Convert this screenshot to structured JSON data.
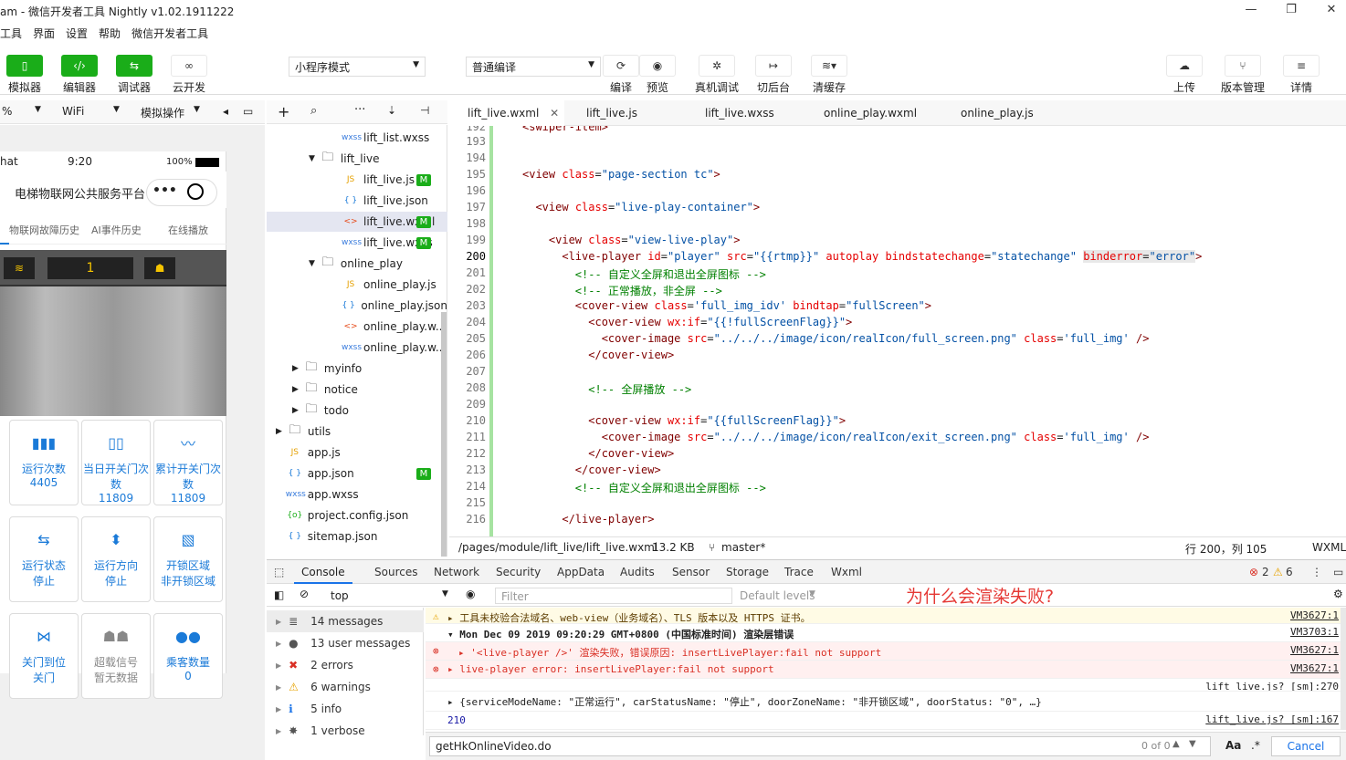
{
  "window": {
    "title": "am - 微信开发者工具 Nightly v1.02.1911222",
    "minimize": "—",
    "maximize": "❐",
    "close": "✕"
  },
  "menu": [
    "工具",
    "界面",
    "设置",
    "帮助",
    "微信开发者工具"
  ],
  "toolbar": {
    "simulator": "模拟器",
    "editor": "编辑器",
    "debugger": "调试器",
    "cloud": "云开发",
    "mode": "小程序模式",
    "compile_mode": "普通编译",
    "compile": "编译",
    "preview": "预览",
    "remote_debug": "真机调试",
    "background": "切后台",
    "clear_cache": "清缓存",
    "upload": "上传",
    "version": "版本管理",
    "details": "详情"
  },
  "simtool": {
    "zoom": "%",
    "network": "WiFi",
    "ops": "模拟操作"
  },
  "phone": {
    "carrier": "hat",
    "time": "9:20",
    "battery": "100%",
    "title": "电梯物联网公共服务平台",
    "tabs": [
      "物联网故障历史",
      "AI事件历史",
      "在线播放"
    ],
    "floor": "1",
    "stats": [
      {
        "label": "运行次数",
        "value": "4405",
        "color": "#1a7ad8"
      },
      {
        "label": "当日开关门次数",
        "value": "11809",
        "color": "#1a7ad8"
      },
      {
        "label": "累计开关门次数",
        "value": "11809",
        "color": "#1a7ad8"
      },
      {
        "label": "运行状态",
        "value": "停止",
        "color": "#1a7ad8"
      },
      {
        "label": "运行方向",
        "value": "停止",
        "color": "#1a7ad8"
      },
      {
        "label": "开锁区域",
        "value": "非开锁区域",
        "color": "#1a7ad8"
      },
      {
        "label": "关门到位",
        "value": "关门",
        "color": "#1a7ad8"
      },
      {
        "label": "超载信号",
        "value": "暂无数据",
        "color": "#888888"
      },
      {
        "label": "乘客数量",
        "value": "0",
        "color": "#1a7ad8"
      }
    ]
  },
  "explorer": [
    {
      "name": "lift_list.wxss",
      "type": "wxss",
      "indent": 2
    },
    {
      "name": "lift_live",
      "type": "folder-open",
      "indent": 1
    },
    {
      "name": "lift_live.js",
      "type": "js",
      "indent": 2,
      "m": "M"
    },
    {
      "name": "lift_live.json",
      "type": "json",
      "indent": 2
    },
    {
      "name": "lift_live.wxml",
      "type": "wxml",
      "indent": 2,
      "m": "M",
      "selected": true
    },
    {
      "name": "lift_live.wxss",
      "type": "wxss",
      "indent": 2,
      "m": "M"
    },
    {
      "name": "online_play",
      "type": "folder-open",
      "indent": 1
    },
    {
      "name": "online_play.js",
      "type": "js",
      "indent": 2
    },
    {
      "name": "online_play.json",
      "type": "json",
      "indent": 2
    },
    {
      "name": "online_play.w...",
      "type": "wxml",
      "indent": 2
    },
    {
      "name": "online_play.w...",
      "type": "wxss",
      "indent": 2
    },
    {
      "name": "myinfo",
      "type": "folder",
      "indent": 0.5
    },
    {
      "name": "notice",
      "type": "folder",
      "indent": 0.5
    },
    {
      "name": "todo",
      "type": "folder",
      "indent": 0.5
    },
    {
      "name": "utils",
      "type": "folder",
      "indent": 0
    },
    {
      "name": "app.js",
      "type": "js",
      "indent": 0.3
    },
    {
      "name": "app.json",
      "type": "json",
      "indent": 0.3,
      "m": "M"
    },
    {
      "name": "app.wxss",
      "type": "wxss",
      "indent": 0.3
    },
    {
      "name": "project.config.json",
      "type": "config",
      "indent": 0.3
    },
    {
      "name": "sitemap.json",
      "type": "json",
      "indent": 0.3
    }
  ],
  "tabs": [
    "lift_live.wxml",
    "lift_live.js",
    "lift_live.wxss",
    "online_play.wxml",
    "online_play.js"
  ],
  "code": [
    {
      "n": "193",
      "html": ""
    },
    {
      "n": "194",
      "html": ""
    },
    {
      "n": "195",
      "html": "<span class='tg'>&lt;view</span> <span class='at'>class</span>=<span class='st'>\"page-section tc\"</span><span class='tg'>&gt;</span>"
    },
    {
      "n": "196",
      "html": ""
    },
    {
      "n": "197",
      "html": "  <span class='tg'>&lt;view</span> <span class='at'>class</span>=<span class='st'>\"live-play-container\"</span><span class='tg'>&gt;</span>"
    },
    {
      "n": "198",
      "html": ""
    },
    {
      "n": "199",
      "html": "    <span class='tg'>&lt;view</span> <span class='at'>class</span>=<span class='st'>\"view-live-play\"</span><span class='tg'>&gt;</span>"
    },
    {
      "n": "200",
      "html": "      <span class='tg'>&lt;live-player</span> <span class='at'>id</span>=<span class='st'>\"player\"</span> <span class='at'>src</span>=<span class='st'>\"{{rtmp}}\"</span> <span class='at'>autoplay</span> <span class='at'>bindstatechange</span>=<span class='st'>\"statechange\"</span> <span class='at' style='background:#e8e8e8'>binderror</span><span style='background:#e8e8e8'>=</span><span class='st' style='background:#e8e8e8'>\"error\"</span><span class='tg'>&gt;</span>"
    },
    {
      "n": "201",
      "html": "        <span class='cm'>&lt;!-- 自定义全屏和退出全屏图标 --&gt;</span>"
    },
    {
      "n": "202",
      "html": "        <span class='cm'>&lt;!-- 正常播放，非全屏 --&gt;</span>"
    },
    {
      "n": "203",
      "html": "        <span class='tg'>&lt;cover-view</span> <span class='at'>class</span>=<span class='st'>'full_img_idv'</span> <span class='at'>bindtap</span>=<span class='st'>\"fullScreen\"</span><span class='tg'>&gt;</span>"
    },
    {
      "n": "204",
      "html": "          <span class='tg'>&lt;cover-view</span> <span class='at'>wx:if</span>=<span class='st'>\"{{!fullScreenFlag}}\"</span><span class='tg'>&gt;</span>"
    },
    {
      "n": "205",
      "html": "            <span class='tg'>&lt;cover-image</span> <span class='at'>src</span>=<span class='st'>\"../../../image/icon/realIcon/full_screen.png\"</span> <span class='at'>class</span>=<span class='st'>'full_img'</span> <span class='tg'>/&gt;</span>"
    },
    {
      "n": "206",
      "html": "          <span class='tg'>&lt;/cover-view&gt;</span>"
    },
    {
      "n": "207",
      "html": ""
    },
    {
      "n": "208",
      "html": "          <span class='cm'>&lt;!-- 全屏播放 --&gt;</span>"
    },
    {
      "n": "209",
      "html": ""
    },
    {
      "n": "210",
      "html": "          <span class='tg'>&lt;cover-view</span> <span class='at'>wx:if</span>=<span class='st'>\"{{fullScreenFlag}}\"</span><span class='tg'>&gt;</span>"
    },
    {
      "n": "211",
      "html": "            <span class='tg'>&lt;cover-image</span> <span class='at'>src</span>=<span class='st'>\"../../../image/icon/realIcon/exit_screen.png\"</span> <span class='at'>class</span>=<span class='st'>'full_img'</span> <span class='tg'>/&gt;</span>"
    },
    {
      "n": "212",
      "html": "          <span class='tg'>&lt;/cover-view&gt;</span>"
    },
    {
      "n": "213",
      "html": "        <span class='tg'>&lt;/cover-view&gt;</span>"
    },
    {
      "n": "214",
      "html": "        <span class='cm'>&lt;!-- 自定义全屏和退出全屏图标 --&gt;</span>"
    },
    {
      "n": "215",
      "html": ""
    },
    {
      "n": "216",
      "html": "      <span class='tg'>&lt;/live-player&gt;</span>"
    }
  ],
  "statusline": {
    "path": "/pages/module/lift_live/lift_live.wxml",
    "size": "13.2 KB",
    "branch": "master*",
    "cursor": "行 200，列 105",
    "lang": "WXML"
  },
  "devtabs": [
    "Console",
    "Sources",
    "Network",
    "Security",
    "AppData",
    "Audits",
    "Sensor",
    "Storage",
    "Trace",
    "Wxml"
  ],
  "devcounts": {
    "errors": "2",
    "warnings": "6"
  },
  "ctool": {
    "context": "top",
    "filter": "Filter",
    "levels": "Default levels"
  },
  "annotation": "为什么会渲染失败?",
  "panel": [
    {
      "label": "14 messages",
      "icon": "list"
    },
    {
      "label": "13 user messages",
      "icon": "user"
    },
    {
      "label": "2 errors",
      "icon": "error"
    },
    {
      "label": "6 warnings",
      "icon": "warning"
    },
    {
      "label": "5 info",
      "icon": "info"
    },
    {
      "label": "1 verbose",
      "icon": "verbose"
    }
  ],
  "log": [
    {
      "text": "▸ 工具未校验合法域名、web-view（业务域名）、TLS 版本以及 HTTPS 证书。",
      "src": "VM3627:1",
      "kind": "warn"
    },
    {
      "text": "▾ Mon Dec 09 2019 09:20:29 GMT+0800 (中国标准时间) 渲染层错误",
      "src": "VM3703:1",
      "kind": "group"
    },
    {
      "text": "▸ '<live-player />' 渲染失败，错误原因: insertLivePlayer:fail not support",
      "src": "VM3627:1",
      "kind": "error"
    },
    {
      "text": "▸ live-player error: insertLivePlayer:fail not support",
      "src": "VM3627:1",
      "kind": "error"
    },
    {
      "text": "",
      "src": "lift_live.js? [sm]:270",
      "kind": "plain"
    },
    {
      "text": "▸ {serviceModeName: \"正常运行\", carStatusName: \"停止\", doorZoneName: \"非开锁区域\", doorStatus: \"0\", …}",
      "src": "",
      "kind": "plain"
    },
    {
      "text": "210",
      "src": "lift_live.js? [sm]:167",
      "kind": "num"
    }
  ],
  "search": {
    "value": "getHkOnlineVideo.do",
    "count": "0 of 0",
    "case": "Aa",
    "regex": ".*",
    "cancel": "Cancel"
  }
}
